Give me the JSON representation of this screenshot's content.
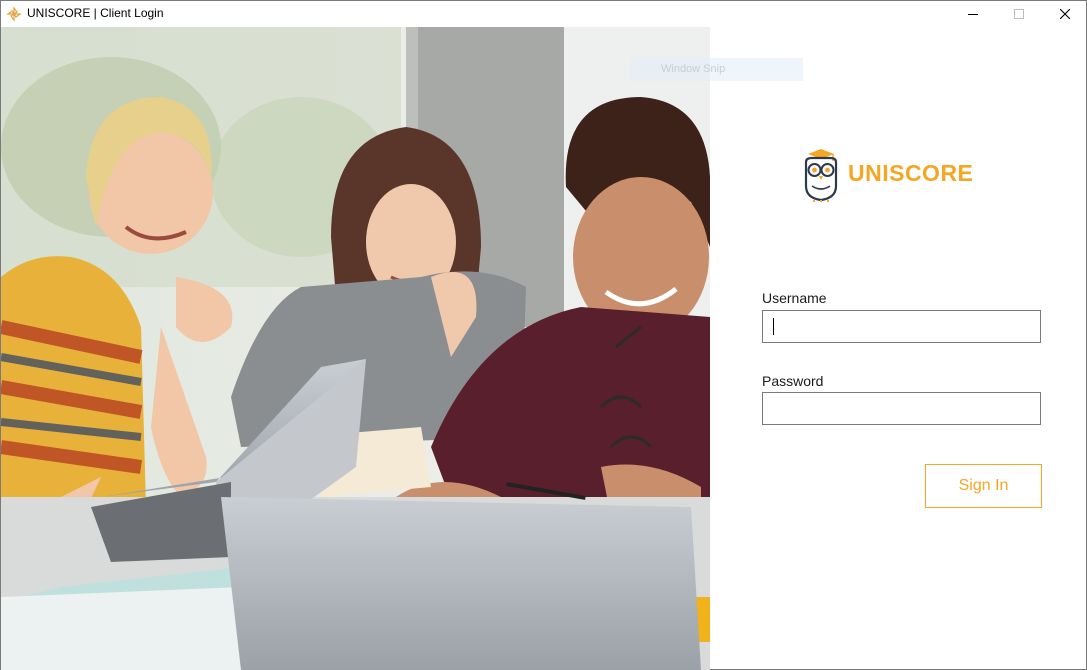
{
  "window": {
    "title": "UNISCORE | Client Login",
    "controls": [
      "minimize-icon",
      "maximize-icon",
      "close-icon"
    ]
  },
  "overlay": {
    "snip_label": "Window Snip"
  },
  "brand": {
    "name": "UNISCORE",
    "color": "#f5a623",
    "logo_icon": "owl-graduate-icon"
  },
  "login": {
    "username_label": "Username",
    "username_value": "",
    "password_label": "Password",
    "password_value": "",
    "submit_label": "Sign In"
  },
  "hero": {
    "image_subject": "students-with-laptops-photo"
  }
}
